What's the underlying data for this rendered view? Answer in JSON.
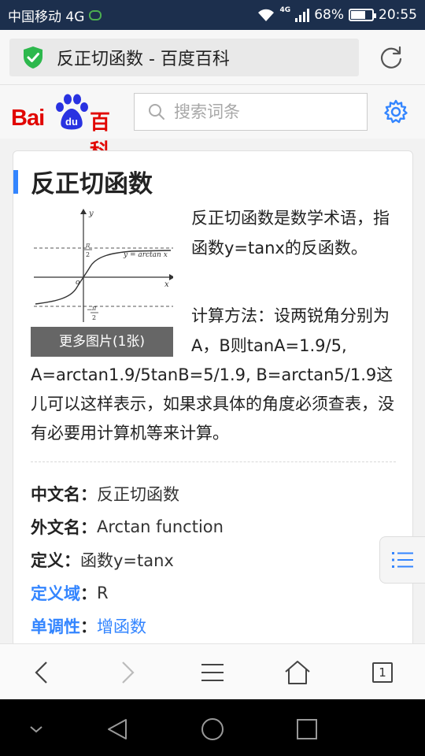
{
  "status_bar": {
    "carrier": "中国移动 4G",
    "net_badge": "4G",
    "battery": "68%",
    "battery_level": 0.68,
    "time": "20:55"
  },
  "address_bar": {
    "page_title": "反正切函数 - 百度百科"
  },
  "header": {
    "logo_bai": "Bai",
    "logo_du": "du",
    "logo_baike": "百科",
    "search_placeholder": "搜索词条"
  },
  "article": {
    "title": "反正切函数",
    "figure": {
      "more_pics": "更多图片(1张)",
      "labels": {
        "y": "y",
        "x": "x",
        "origin": "o",
        "curve": "y = arctan x",
        "pi": "π",
        "two": "2",
        "minus": "−"
      }
    },
    "summary": "反正切函数是数学术语，指函数y=tanx的反函数。",
    "method_lead": "计算方法：设两锐角分别为A，B则tanA=1.9/5,",
    "method_rest": "A=arctan1.9/5tanB=5/1.9, B=arctan5/1.9这儿可以这样表示，如果求具体的角度必须查表，没有必要用计算机等来计算。",
    "info": [
      {
        "key": "中文名",
        "value": "反正切函数",
        "link": false
      },
      {
        "key": "外文名",
        "value": "Arctan function",
        "link": false
      },
      {
        "key": "定义",
        "value": "函数y=tanx",
        "link": false
      },
      {
        "key": "定义域",
        "value": "R",
        "link": true
      },
      {
        "key": "单调性",
        "value": "增函数",
        "link": true
      }
    ],
    "colon": "："
  },
  "toolbar": {
    "tab_count": "1"
  },
  "colors": {
    "accent": "#3385ff",
    "brand_red": "#e10601",
    "brand_blue": "#2932e1",
    "status_bar": "#1c2f4d",
    "shield": "#2db84d"
  }
}
